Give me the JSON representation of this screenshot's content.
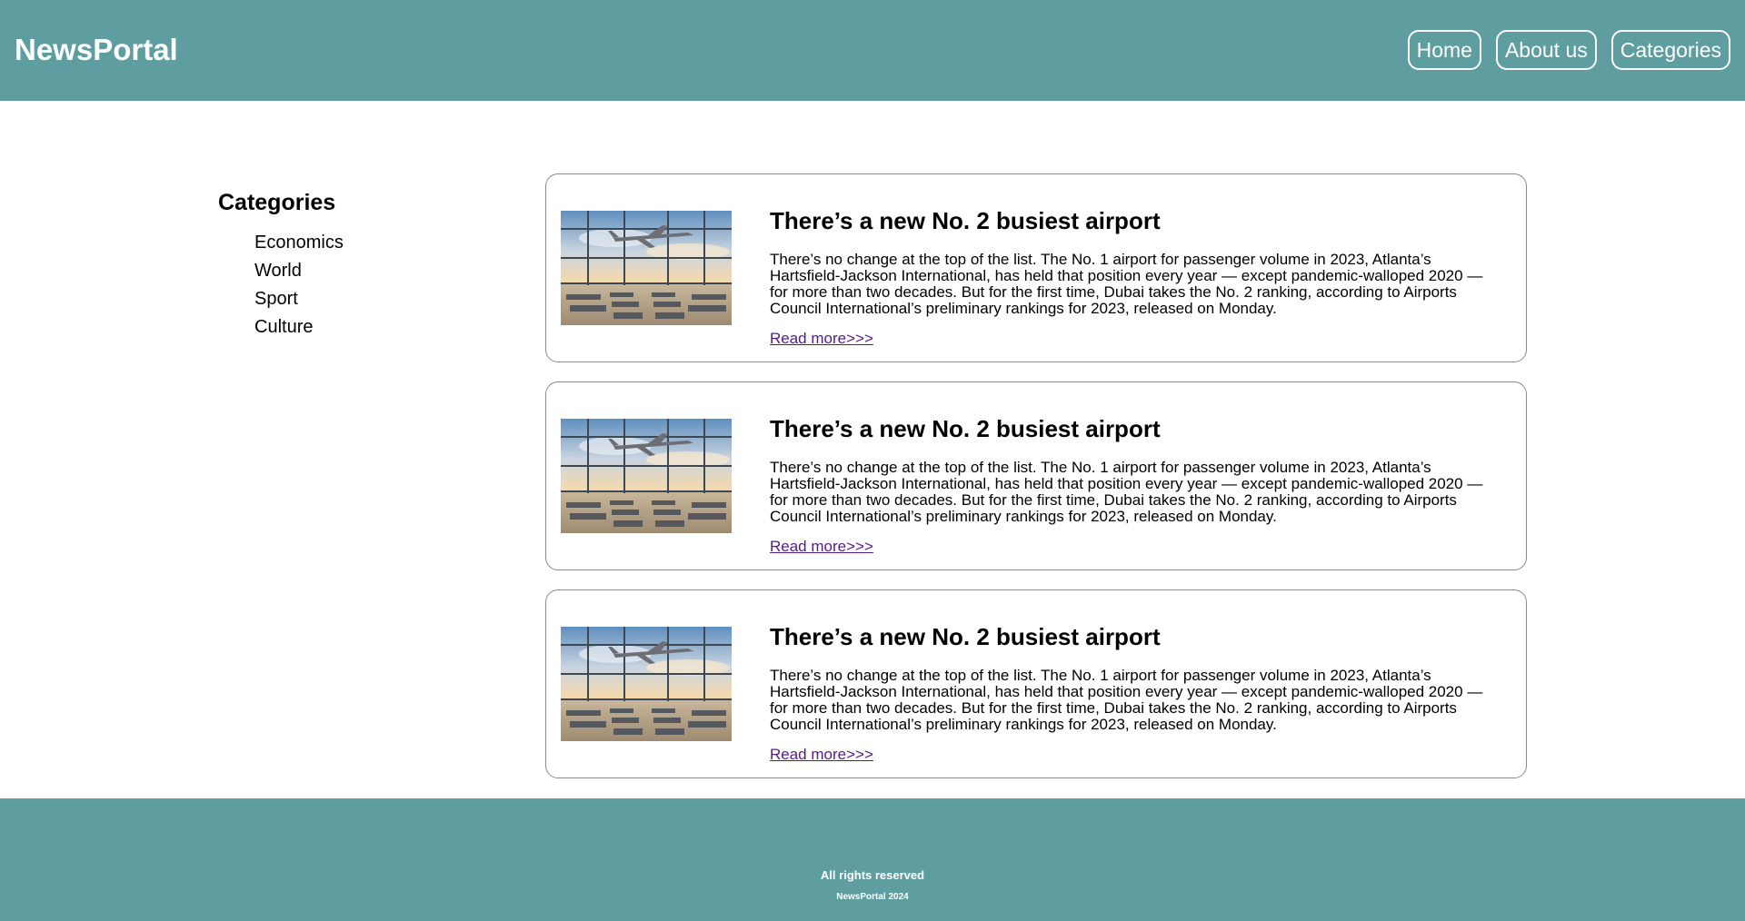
{
  "header": {
    "logo": "NewsPortal",
    "nav": [
      {
        "label": "Home"
      },
      {
        "label": "About us"
      },
      {
        "label": "Categories"
      }
    ]
  },
  "sidebar": {
    "title": "Categories",
    "items": [
      "Economics",
      "World",
      "Sport",
      "Culture"
    ]
  },
  "articles": [
    {
      "title": "There’s a new No. 2 busiest airport",
      "text": "There’s no change at the top of the list. The No. 1 airport for passenger volume in 2023, Atlanta’s Hartsfield-Jackson International, has held that position every year — except pandemic-walloped 2020 — for more than two decades. But for the first time, Dubai takes the No. 2 ranking, according to Airports Council International’s preliminary rankings for 2023, released on Monday.",
      "link": "Read more>>>"
    },
    {
      "title": "There’s a new No. 2 busiest airport",
      "text": "There’s no change at the top of the list. The No. 1 airport for passenger volume in 2023, Atlanta’s Hartsfield-Jackson International, has held that position every year — except pandemic-walloped 2020 — for more than two decades. But for the first time, Dubai takes the No. 2 ranking, according to Airports Council International’s preliminary rankings for 2023, released on Monday.",
      "link": "Read more>>>"
    },
    {
      "title": "There’s a new No. 2 busiest airport",
      "text": "There’s no change at the top of the list. The No. 1 airport for passenger volume in 2023, Atlanta’s Hartsfield-Jackson International, has held that position every year — except pandemic-walloped 2020 — for more than two decades. But for the first time, Dubai takes the No. 2 ranking, according to Airports Council International’s preliminary rankings for 2023, released on Monday.",
      "link": "Read more>>>"
    }
  ],
  "footer": {
    "line1": "All rights reserved",
    "line2": "NewsPortal 2024"
  },
  "colors": {
    "brand": "#5f9ea0",
    "link": "#551a8b"
  }
}
